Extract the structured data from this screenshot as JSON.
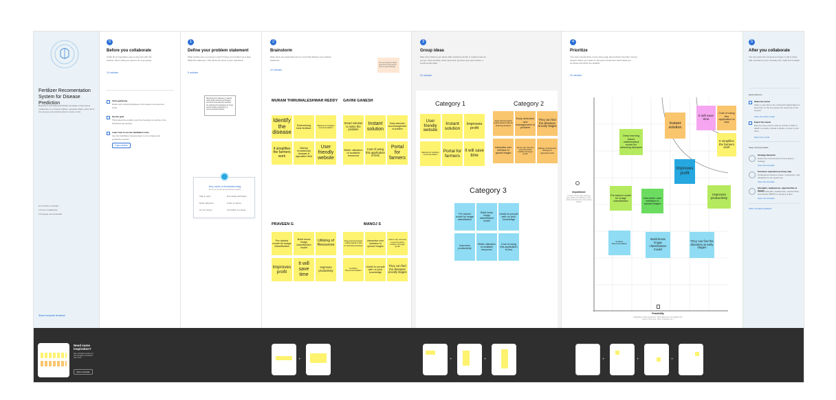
{
  "intro": {
    "title": "Fertilizer Recomentation System for Disease Prediction",
    "body": "Brainstorm and idea prioritization template to help teams collaborate on a shared problem, generate ideas, group them into themes and prioritize what to work on first.",
    "stats": [
      "10 minutes to prepare",
      "1 hour to collaborate",
      "2-8 people recommended"
    ],
    "footer_link": "Share template feedback"
  },
  "steps": [
    {
      "num": "0",
      "title": "Before you collaborate",
      "text": "A little bit of preparation goes a long way with this session. Here's what you need to do to get going.",
      "time": "10 minutes",
      "items": [
        {
          "title": "Team gathering",
          "text": "Define who should participate in the session and send an invite."
        },
        {
          "title": "Set the goal",
          "text": "Think about the problem you'll be focusing on solving in the brainstorming session."
        },
        {
          "title": "Learn how to use the facilitation tools",
          "text": "Use the Facilitation Superpowers to run a happy and productive session."
        }
      ],
      "button": "Open article"
    },
    {
      "num": "1",
      "title": "Define your problem statement",
      "text": "What problem are you trying to solve? Frame your problem as a How Might We statement. This will be the focus of your brainstorm.",
      "time": "5 minutes",
      "problem": "Identifying the disease on plants using deep learning techniques and recommending the fertilizer for reducing the diseases of crops and increase production by recommended fertilizer.",
      "rules_title": "Key rules of brainstorming",
      "rules_sub": "To run an smooth and productive session",
      "rules": [
        "Stay in topic.",
        "Encourage wild ideas.",
        "Defer judgment.",
        "Listen to others.",
        "Go for volume.",
        "If possible, be visual."
      ]
    },
    {
      "num": "2",
      "title": "Brainstorm",
      "text": "Write down any ideas that come to mind that address your problem statement.",
      "time": "10 minutes",
      "tip": "You can select a sticky note and hit the pencil icon to start drawing!"
    },
    {
      "num": "3",
      "title": "Group ideas",
      "text": "Take turns sharing your ideas while clustering similar or related notes as you go. Once all sticky notes have been grouped, give each cluster a sentence-like label.",
      "time": "20 minutes"
    },
    {
      "num": "4",
      "title": "Prioritize",
      "text": "Your team should all be on the same page about what's important moving forward. Place your ideas on this grid to determine which ideas are important and which are feasible.",
      "time": "20 minutes"
    },
    {
      "num": "5",
      "title": "After you collaborate",
      "text": "You can export the mural as an image or pdf to share with members of your company who might find it helpful.",
      "time": ""
    }
  ],
  "brainstorm": {
    "people": [
      {
        "name": "MURAM THIRUMALESHWAR REDDY",
        "notes": [
          "Identify the disease",
          "Determining best fertilizer",
          "Website for Fertilizer recommendation",
          "It simplifies the farmers work",
          "Making revolutionary changes in agriculture field",
          "User friendly website"
        ]
      },
      {
        "name": "GAVINI GANESH",
        "notes": [
          "Smart solution to solve the problem",
          "Instant solution",
          "Early detection and management of problem",
          "Better utilization of available resources",
          "Cost of using this application is less",
          "Portal for farmers"
        ]
      },
      {
        "name": "PRAVEEN G",
        "notes": [
          "Pre trained model for image classification",
          "Build keras image classification model",
          "Utilizing of Resources",
          "Improves profit",
          "It will save time",
          "Improves productivity"
        ]
      },
      {
        "name": "MANOJ S",
        "notes": [
          "Deep learning based mathematical model for detecting diseases",
          "Interactive user interface to upload images",
          "Admin can view the recommended fertilizer through gmail",
          "Fertilizer Recommendation",
          "Useful to people with no prior knowledge",
          "They can find the diseases at early stages"
        ]
      }
    ]
  },
  "groups": {
    "categories": [
      {
        "name": "Category 1",
        "notes": [
          "User friendly website",
          "Instant solution",
          "Improves profit",
          "Website for Fertilizer recommendation",
          "Portal for farmers",
          "It will save time"
        ]
      },
      {
        "name": "Category 2",
        "notes": [
          "Deep learning based mathematical model for detecting diseases",
          "Early detection and management of problem",
          "They can find the diseases at early stages",
          "Interactive user interface to upload images",
          "Admin can view the recommended fertilizer through gmail",
          "Making revolutionary changes in agriculture field"
        ]
      },
      {
        "name": "Category 3",
        "notes": [
          "Pre trained model for image classification",
          "Build keras image classification model",
          "Useful to people with no prior knowledge",
          "Improves productivity",
          "Better utilization of available resources",
          "Cost of using this application is less"
        ]
      }
    ]
  },
  "prioritize": {
    "y_label": "Importance",
    "y_text": "If each of these tasks could get done without any difficulty or cost, which would have the most positive impact?",
    "x_label": "Feasibility",
    "x_text": "Regardless of their importance, which tasks are more feasible than others? (Cost, time, effort, complexity, etc.)",
    "notes": [
      "Deep learning based mathematical model for detecting diseases",
      "Instant solution",
      "It will save time",
      "Cost of using this application is less",
      "It simplifies the farmers work",
      "Improves profit",
      "Pre trained model for image classification",
      "Interactive user interface to upload images",
      "Improves productivity",
      "Fertilizer Recommendation",
      "Build keras image classification model",
      "They can find the diseases at early stages"
    ]
  },
  "after": {
    "quick_title": "Quick add-ons",
    "quick": [
      {
        "title": "Share the mural",
        "text": "Share a view link to the mural with stakeholders to keep them in the loop about the outcomes of the session.",
        "link": "Open the share modal"
      },
      {
        "title": "Export the mural",
        "text": "Export a copy of the mural as a PNG or PDF to attach to emails, include in slides, or save in your drive.",
        "link": "Export the mural"
      }
    ],
    "keep_title": "Keep moving forward",
    "keep": [
      {
        "title": "Strategy blueprint",
        "text": "Define the components of a new idea or strategy.",
        "link": "Open the template"
      },
      {
        "title": "Customer experience journey map",
        "text": "Understand customer needs, motivations, and obstacles for an experience.",
        "link": "Open the template"
      },
      {
        "title": "Strengths, weaknesses, opportunities & threats",
        "text": "Identify strengths, weaknesses, opportunities, and threats (SWOT) to develop a plan.",
        "link": "Open the template"
      }
    ],
    "footer_link": "Share template feedback"
  },
  "strip": {
    "title": "Need some inspiration?",
    "text": "See a finished version of this template to kickstart your work.",
    "button": "Open example"
  },
  "colors": {
    "accent": "#2a6fd6",
    "yellow": "#fdf36e",
    "orange": "#f9c56d",
    "blue": "#8fdcf4",
    "green": "#6bdc60",
    "strip": "#2f2f2f"
  }
}
